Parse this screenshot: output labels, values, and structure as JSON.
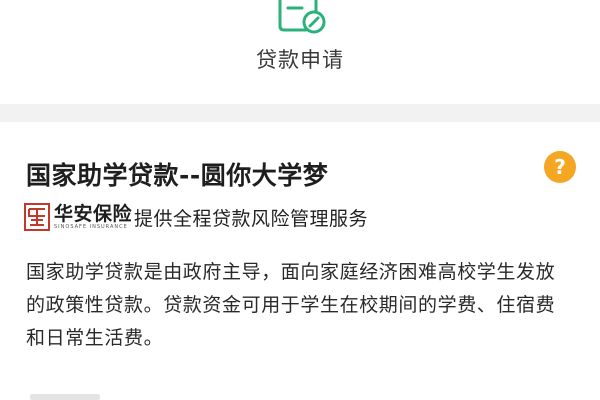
{
  "header": {
    "icon": "loan-application-document-icon",
    "label": "贷款申请"
  },
  "card": {
    "title": "国家助学贷款--圆你大学梦",
    "help_icon_glyph": "?",
    "insurer": {
      "logo_icon": "sinosafe-logo-icon",
      "brand_name": "华安保险",
      "brand_en": "SINOSAFE INSURANCE",
      "tagline": "提供全程贷款风险管理服务"
    },
    "description": "国家助学贷款是由政府主导，面向家庭经济困难高校学生发放的政策性贷款。贷款资金可用于学生在校期间的学费、住宿费和日常生活费。"
  },
  "colors": {
    "accent_green": "#2bb27a",
    "help_orange": "#f5a623",
    "logo_red": "#c0392b",
    "divider_gray": "#f2f2f2"
  }
}
